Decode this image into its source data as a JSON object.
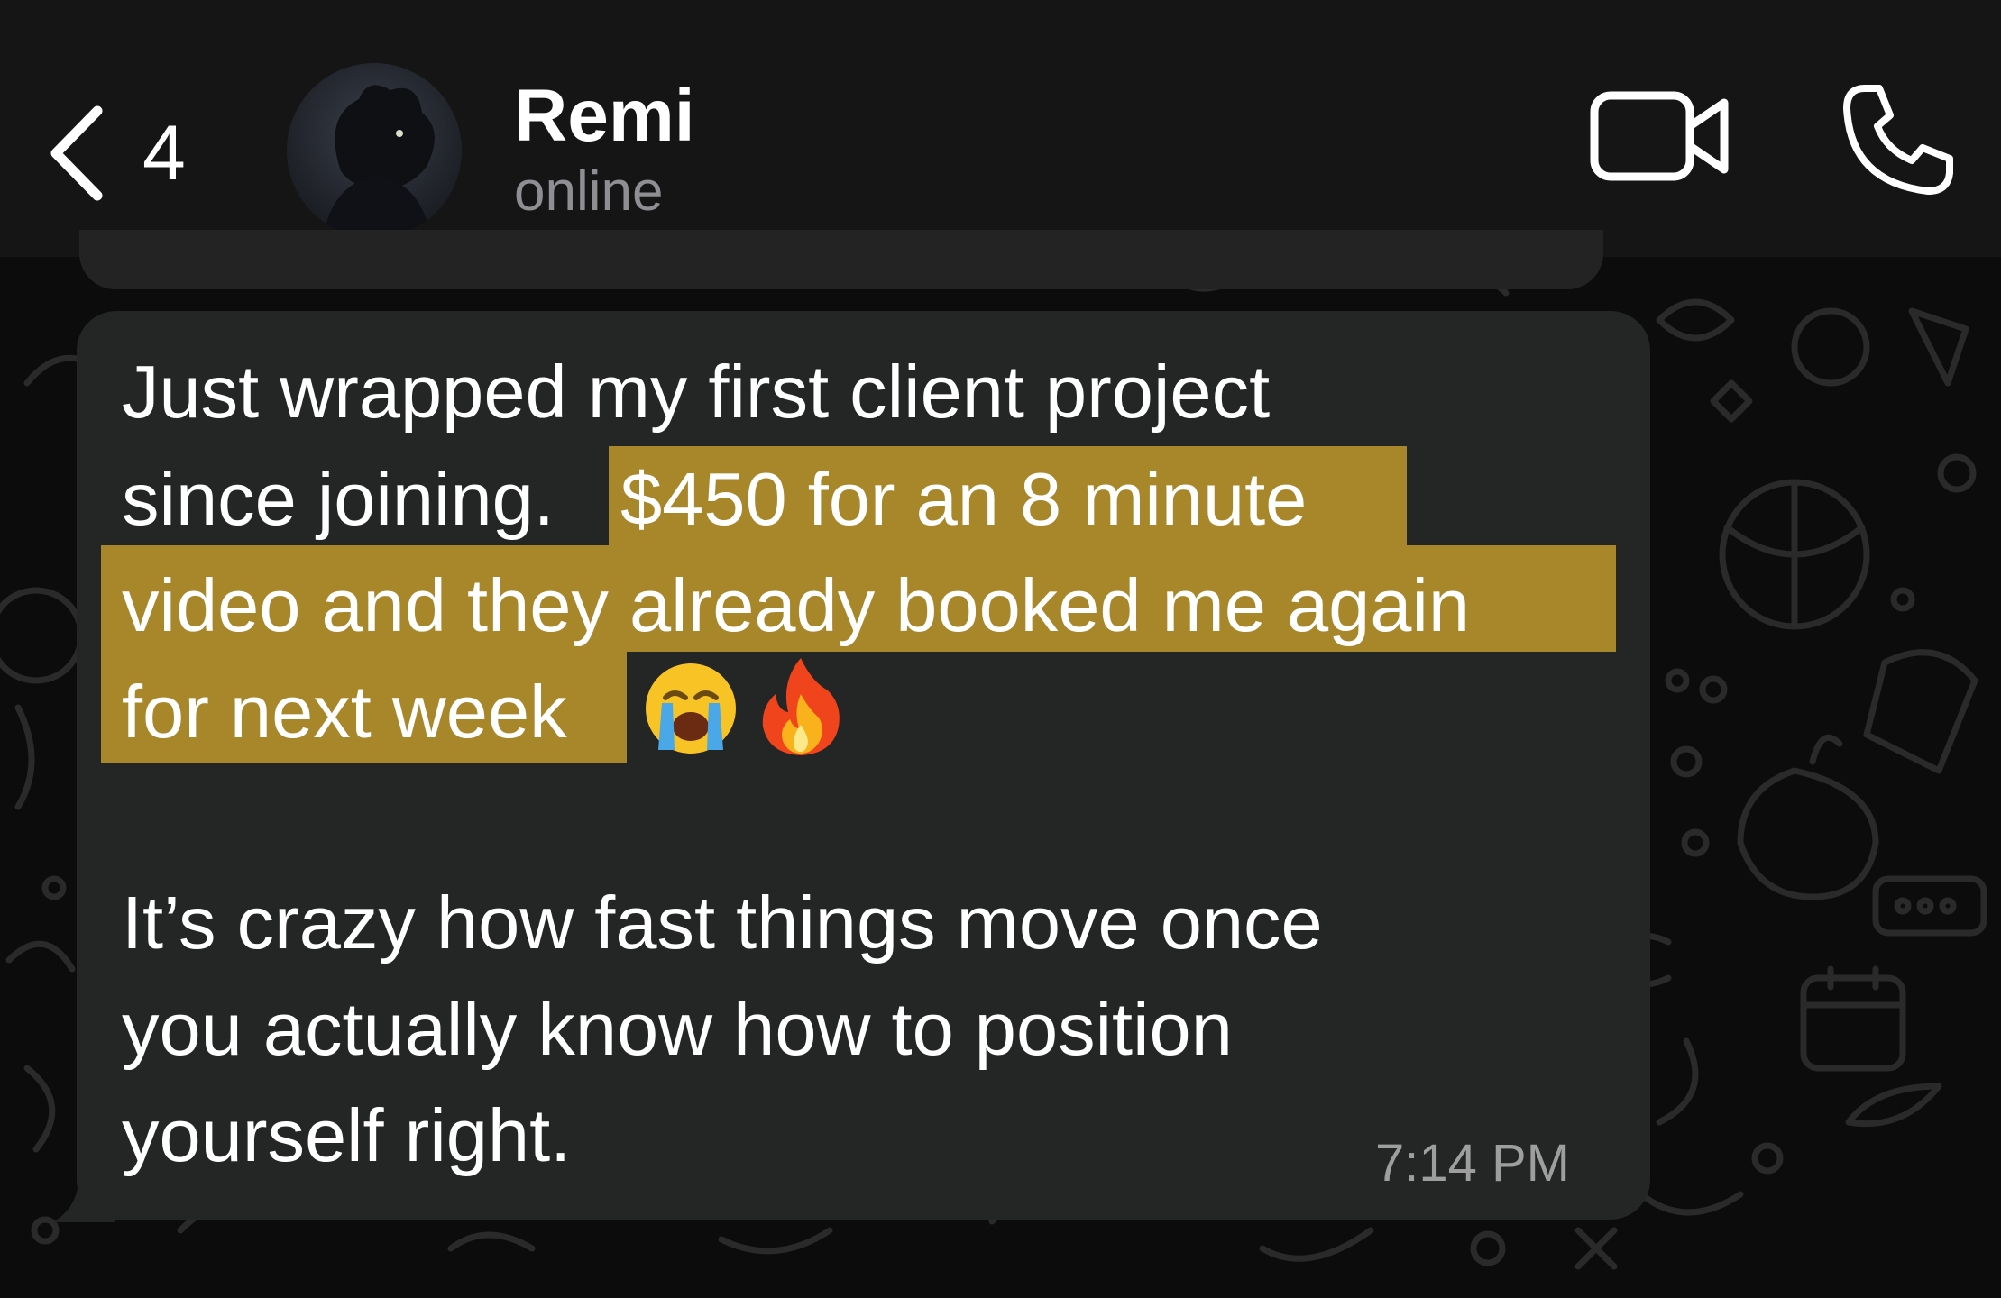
{
  "header": {
    "back_count": "4",
    "contact_name": "Remi",
    "contact_status": "online"
  },
  "message": {
    "lines": [
      "Just wrapped my first client project",
      "since joining.",
      "$450 for an 8 minute",
      "video and they already booked me again",
      "for next week",
      "It’s crazy how fast things move once",
      "you actually know how to position",
      "yourself right."
    ],
    "emojis": [
      "loudly-crying-face",
      "fire"
    ],
    "timestamp": "7:14 PM"
  },
  "colors": {
    "header_bg": "#151515",
    "bubble_bg": "#242525",
    "highlight": "#a8862a",
    "text": "#ffffff",
    "secondary_text": "#8e8e93"
  }
}
